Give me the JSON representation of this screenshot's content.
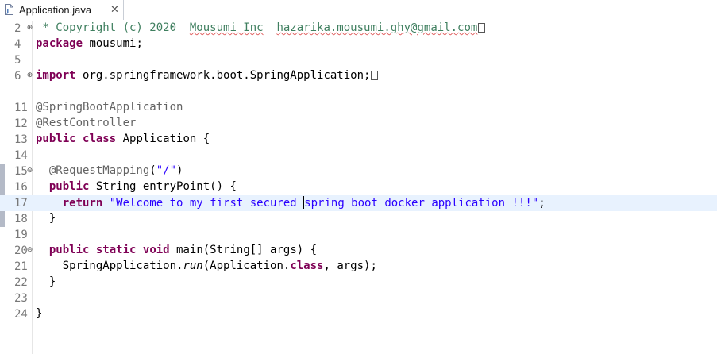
{
  "tab": {
    "label": "Application.java",
    "close": "✕"
  },
  "gutter": [
    "2",
    "4",
    "5",
    "6",
    "11",
    "12",
    "13",
    "14",
    "15",
    "16",
    "17",
    "18",
    "19",
    "20",
    "21",
    "22",
    "23",
    "24"
  ],
  "code": {
    "l2_comment": " * Copyright (c) 2020  ",
    "l2_company": "Mousumi Inc",
    "l2_space": "  ",
    "l2_email": "hazarika.mousumi.ghy@gmail.com",
    "kw_package": "package",
    "l4_rest": " mousumi;",
    "kw_import": "import",
    "l6_rest": " org.springframework.boot.SpringApplication;",
    "ann_spring": "@SpringBootApplication",
    "ann_rest": "@RestController",
    "kw_public": "public",
    "kw_class": "class",
    "l13_rest": " Application {",
    "ann_mapping": "@RequestMapping",
    "l15_paren_open": "(",
    "l15_str": "\"/\"",
    "l15_paren_close": ")",
    "l16_rest": " String entryPoint() {",
    "kw_return": "return",
    "l17_str_a": "\"Welcome to my first secured ",
    "l17_str_b": "spring boot docker application !!!\"",
    "l17_semicolon": ";",
    "brace_close": "}",
    "kw_static": "static",
    "kw_void": "void",
    "l20_rest": " main(String[] args) {",
    "l21_pre": "SpringApplication.",
    "l21_run": "run",
    "l21_rest": "(Application.",
    "kw_class_lit": "class",
    "l21_end": ", args);"
  }
}
